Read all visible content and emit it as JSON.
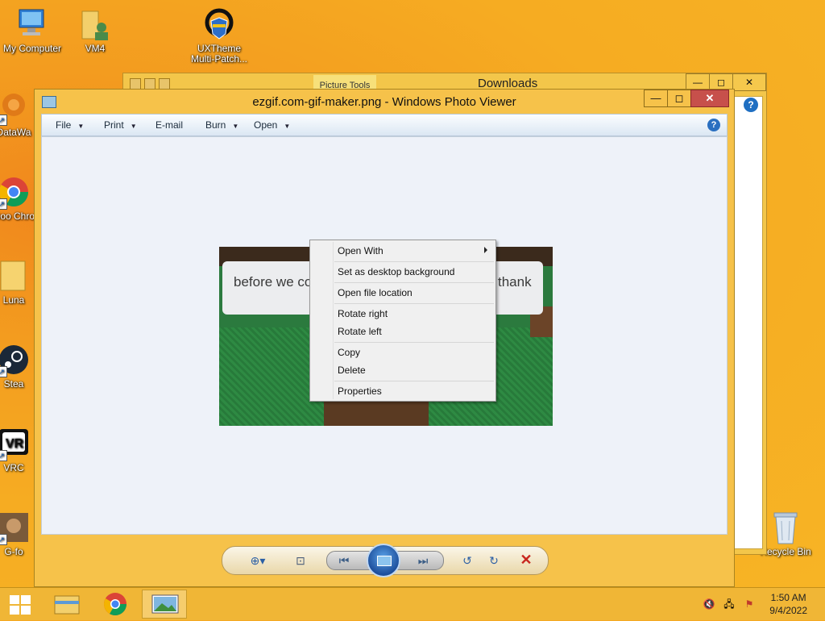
{
  "desktop": {
    "icons": [
      {
        "label": "My Computer",
        "kind": "computer-icon"
      },
      {
        "label": "VM4",
        "kind": "user-folder-icon"
      },
      {
        "label": "UXTheme Multi-Patch...",
        "kind": "uxtheme-icon"
      },
      {
        "label": "DataWa",
        "kind": "datawarrior-icon"
      },
      {
        "label": "Goo Chro",
        "kind": "chrome-icon"
      },
      {
        "label": "Luna",
        "kind": "folder-icon"
      },
      {
        "label": "Stea",
        "kind": "steam-icon"
      },
      {
        "label": "VRC",
        "kind": "vrchat-icon"
      },
      {
        "label": "G-fo",
        "kind": "app-icon"
      },
      {
        "label": "Recycle Bin",
        "kind": "recycle-bin-icon"
      }
    ]
  },
  "explorer": {
    "contextual_tab": "Picture Tools",
    "title": "Downloads",
    "controls": {
      "minimize": "—",
      "maximize": "◻",
      "close": "✕"
    }
  },
  "viewer": {
    "title": "ezgif.com-gif-maker.png - Windows Photo Viewer",
    "controls": {
      "minimize": "—",
      "maximize": "◻",
      "close": "✕"
    },
    "menu": {
      "file": "File",
      "print": "Print",
      "email": "E-mail",
      "burn": "Burn",
      "open": "Open",
      "help": "?"
    },
    "image_text": {
      "left": "before we co",
      "right": "thank"
    }
  },
  "context_menu": {
    "items": [
      {
        "label": "Open With",
        "has_submenu": true
      },
      {
        "label": "Set as desktop background"
      },
      {
        "label": "Open file location"
      },
      {
        "label": "Rotate right"
      },
      {
        "label": "Rotate left"
      },
      {
        "label": "Copy"
      },
      {
        "label": "Delete"
      },
      {
        "label": "Properties"
      }
    ]
  },
  "controlbar": {
    "icons": [
      "zoom-icon",
      "actual-size-icon",
      "previous-icon",
      "slideshow-icon",
      "next-icon",
      "rotate-left-icon",
      "rotate-right-icon",
      "delete-icon"
    ]
  },
  "taskbar": {
    "items": [
      "file-explorer-icon",
      "chrome-icon",
      "photo-viewer-icon"
    ],
    "clock": {
      "time": "1:50 AM",
      "date": "9/4/2022"
    }
  }
}
